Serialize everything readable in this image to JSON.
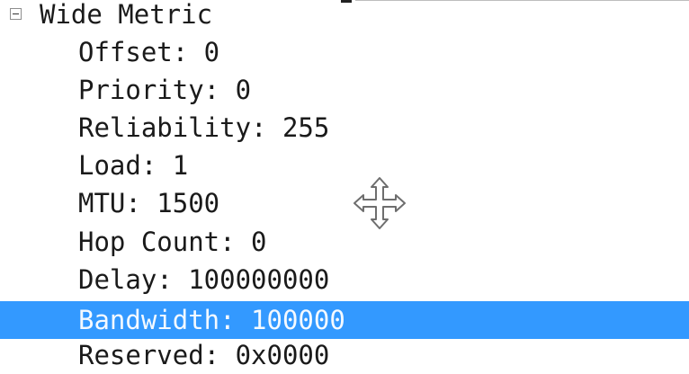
{
  "tree": {
    "group": {
      "label": "Wide Metric",
      "expanded": true,
      "expander_icon": "collapse-box-icon"
    },
    "fields": [
      {
        "label": "Offset: 0"
      },
      {
        "label": "Priority: 0"
      },
      {
        "label": "Reliability: 255"
      },
      {
        "label": "Load: 1"
      },
      {
        "label": "MTU: 1500"
      },
      {
        "label": "Hop Count: 0"
      },
      {
        "label": "Delay: 100000000"
      },
      {
        "label": "Bandwidth: 100000",
        "selected": true
      },
      {
        "label": "Reserved: 0x0000"
      }
    ]
  },
  "cursor": {
    "icon": "move-cursor-icon"
  },
  "colors": {
    "selection_background": "#3399ff",
    "selection_text": "#f4f9ff",
    "text": "#1a1a1a",
    "background": "#ffffff"
  }
}
